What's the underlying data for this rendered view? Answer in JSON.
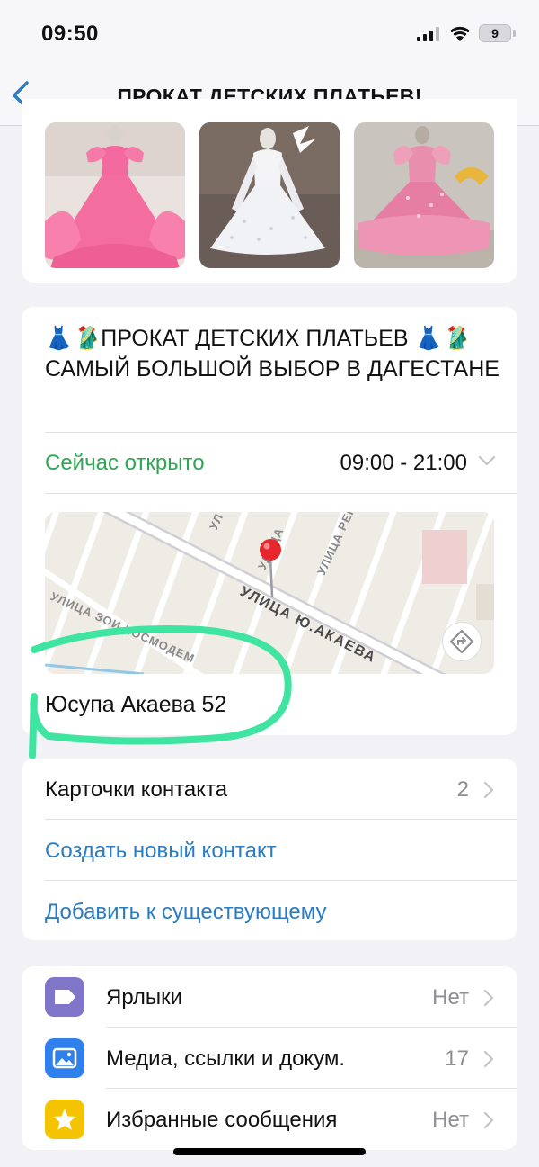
{
  "status_bar": {
    "time": "09:50",
    "battery": "9"
  },
  "nav": {
    "title": "ПРОКАТ ДЕТСКИХ ПЛАТЬЕВ!"
  },
  "info": {
    "description": "👗🥻ПРОКАТ ДЕТСКИХ ПЛАТЬЕВ 👗🥻 САМЫЙ БОЛЬШОЙ ВЫБОР В ДАГЕСТАНЕ",
    "open_status": "Сейчас открыто",
    "hours": "09:00 - 21:00",
    "address": "Юсупа Акаева 52"
  },
  "map": {
    "labels": {
      "main_street": "УЛИЦА Ю.АКАЕВА",
      "street_zoi": "УЛИЦА ЗОИ КОСМОДЕМ",
      "street_top1": "УЛИЦА",
      "street_top2": "УЛИЦА РЕП",
      "street_top3": "УЛ"
    }
  },
  "contacts": {
    "cards_label": "Карточки контакта",
    "cards_count": "2",
    "create_label": "Создать новый контакт",
    "add_label": "Добавить к существующему"
  },
  "settings": [
    {
      "label": "Ярлыки",
      "value": "Нет",
      "icon": "tag-icon",
      "color": "#7f76c9"
    },
    {
      "label": "Медиа, ссылки и докум.",
      "value": "17",
      "icon": "photo-icon",
      "color": "#2f80ed"
    },
    {
      "label": "Избранные сообщения",
      "value": "Нет",
      "icon": "star-icon",
      "color": "#f5c400"
    }
  ],
  "colors": {
    "accent_link": "#2a7cc4",
    "open_green": "#2fa654",
    "highlight_marker": "#3fe4a0"
  }
}
